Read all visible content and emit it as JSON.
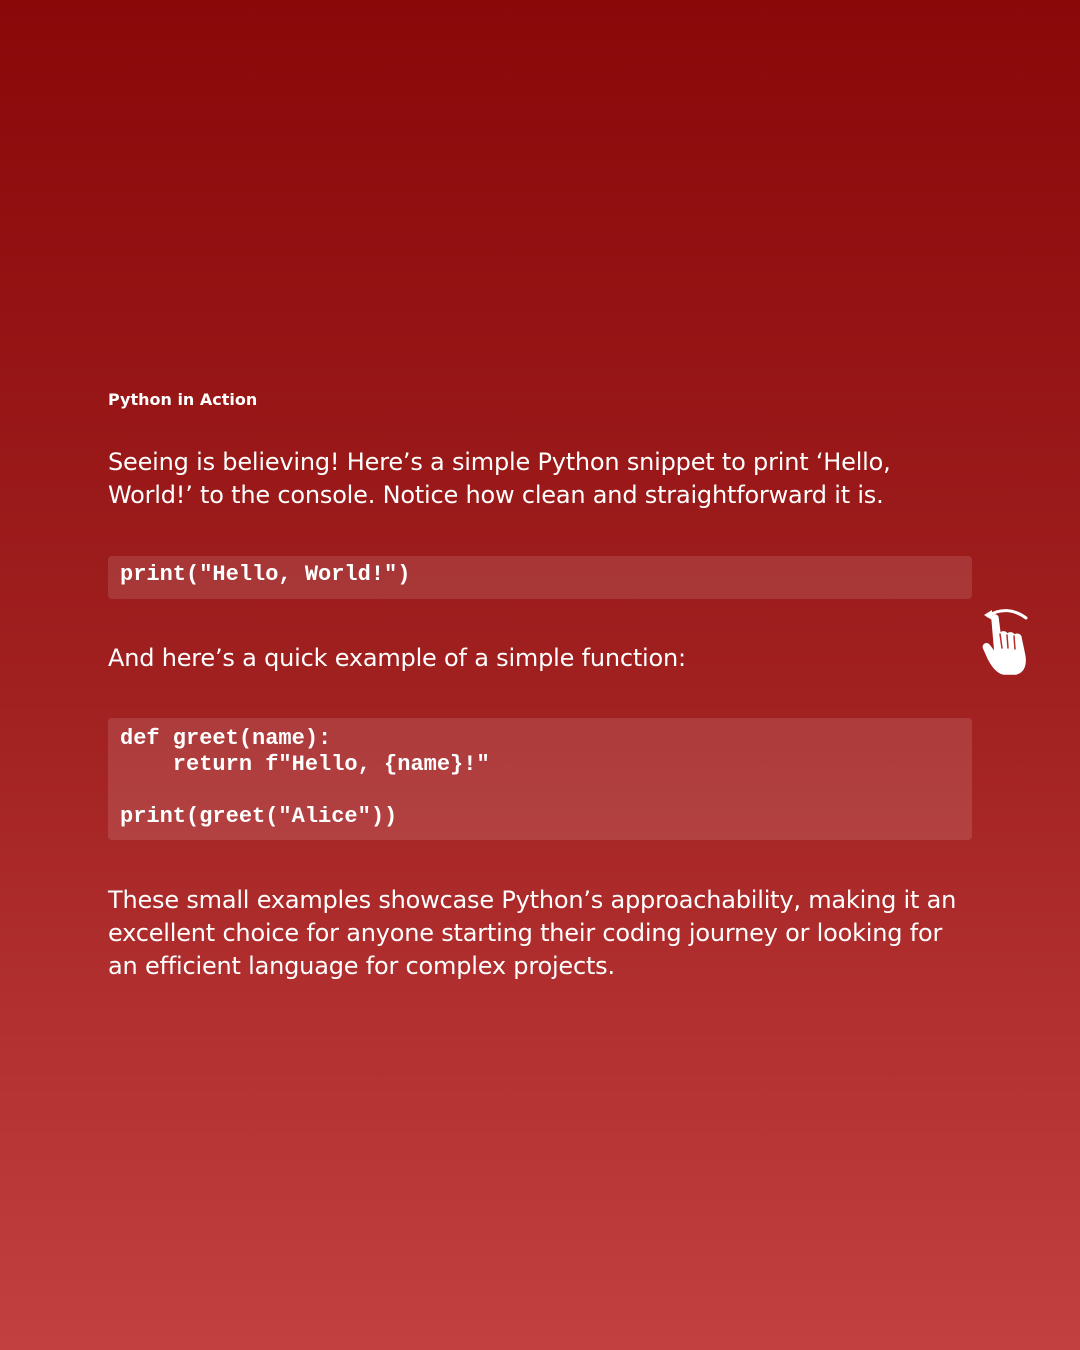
{
  "eyebrow": "Python in Action",
  "intro": "Seeing is believing! Here’s a simple Python snippet to print ‘Hello, World!’ to the console. Notice how clean and straightforward it is.",
  "code_snippet_1": "print(\"Hello, World!\")",
  "function_intro": "And here’s a quick example of a simple function:",
  "code_snippet_2": "def greet(name):\n    return f\"Hello, {name}!\"\n\nprint(greet(\"Alice\"))",
  "conclusion": "These small examples showcase Python’s approachability, making it an excellent choice for anyone starting their coding journey or looking for an efficient language for complex projects.",
  "icons": {
    "swipe_hint": "swipe-hand-icon"
  },
  "colors": {
    "background_top": "#8b0809",
    "background_bottom": "#c34040",
    "text": "#ffffff"
  }
}
